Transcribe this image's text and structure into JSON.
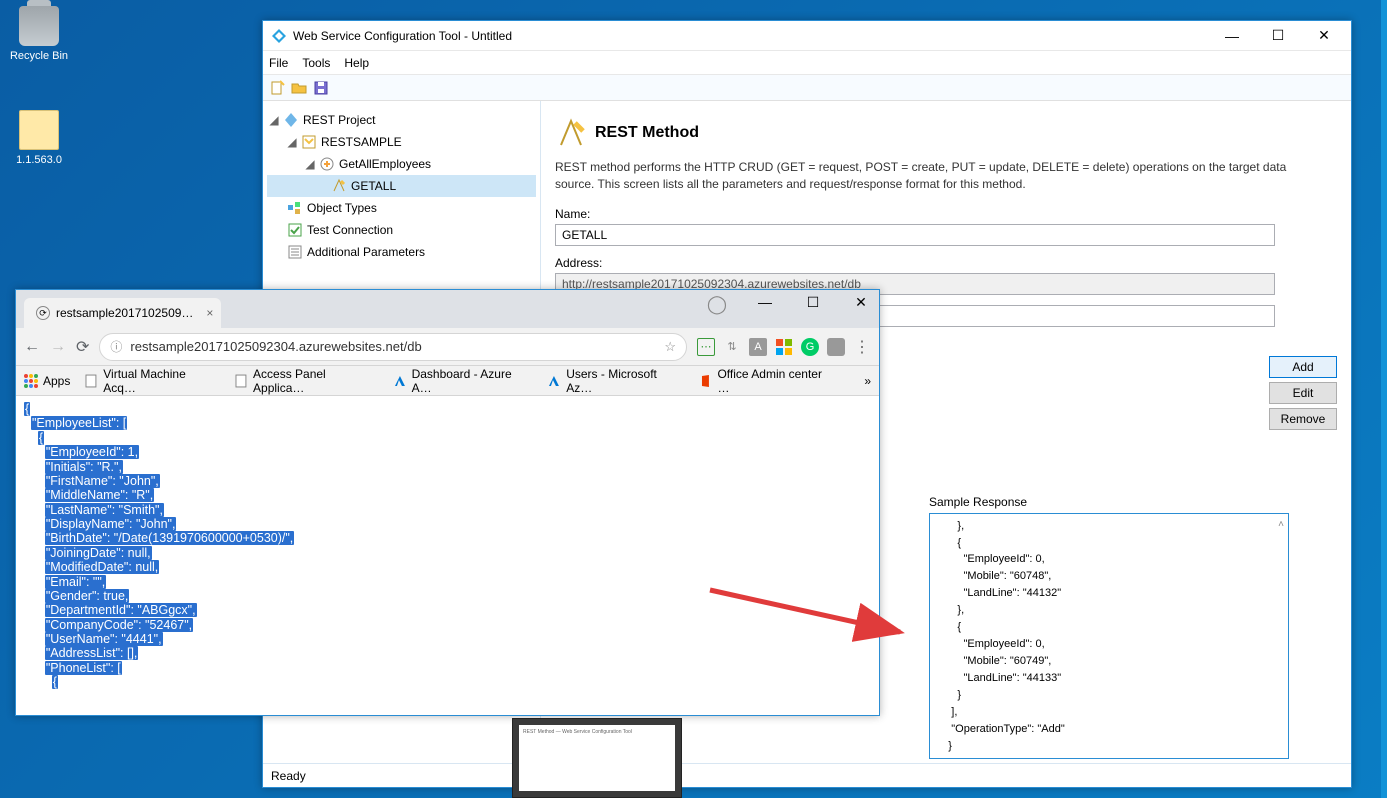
{
  "desktop": {
    "recycle_bin": "Recycle Bin",
    "folder": "1.1.563.0"
  },
  "config_window": {
    "title": "Web Service Configuration Tool - Untitled",
    "menu": {
      "file": "File",
      "tools": "Tools",
      "help": "Help"
    },
    "tree": {
      "root": "REST Project",
      "sample": "RESTSAMPLE",
      "getall_emp": "GetAllEmployees",
      "getall": "GETALL",
      "object_types": "Object Types",
      "test_conn": "Test Connection",
      "add_params": "Additional Parameters"
    },
    "content": {
      "heading": "REST Method",
      "desc": "REST method performs the HTTP CRUD (GET = request, POST = create, PUT = update, DELETE = delete) operations on the target data source. This screen lists all the parameters and request/response format for this method.",
      "name_label": "Name:",
      "name_value": "GETALL",
      "address_label": "Address:",
      "address_value": "http://restsample20171025092304.azurewebsites.net/db",
      "sample_response_label": "Sample Response",
      "sample_response_text": "       },\n       {\n         \"EmployeeId\": 0,\n         \"Mobile\": \"60748\",\n         \"LandLine\": \"44132\"\n       },\n       {\n         \"EmployeeId\": 0,\n         \"Mobile\": \"60749\",\n         \"LandLine\": \"44133\"\n       }\n     ],\n     \"OperationType\": \"Add\"\n    }\n  ]\n}]"
    },
    "buttons": {
      "add": "Add",
      "edit": "Edit",
      "remove": "Remove"
    },
    "status": "Ready"
  },
  "chrome_window": {
    "tab_title": "restsample2017102509…",
    "url": "restsample20171025092304.azurewebsites.net/db",
    "bookmarks": {
      "apps": "Apps",
      "vm": "Virtual Machine Acq…",
      "access": "Access Panel Applica…",
      "dashboard": "Dashboard - Azure A…",
      "users": "Users - Microsoft Az…",
      "office": "Office Admin center …",
      "overflow": "»"
    },
    "json_lines": [
      "{",
      "  \"EmployeeList\": [",
      "    {",
      "      \"EmployeeId\": 1,",
      "      \"Initials\": \"R.\",",
      "      \"FirstName\": \"John\",",
      "      \"MiddleName\": \"R\",",
      "      \"LastName\": \"Smith\",",
      "      \"DisplayName\": \"John\",",
      "      \"BirthDate\": \"/Date(1391970600000+0530)/\",",
      "      \"JoiningDate\": null,",
      "      \"ModifiedDate\": null,",
      "      \"Email\": \"\",",
      "      \"Gender\": true,",
      "      \"DepartmentId\": \"ABGgcx\",",
      "      \"CompanyCode\": \"52467\",",
      "      \"UserName\": \"4441\",",
      "      \"AddressList\": [],",
      "      \"PhoneList\": [",
      "        {"
    ]
  }
}
